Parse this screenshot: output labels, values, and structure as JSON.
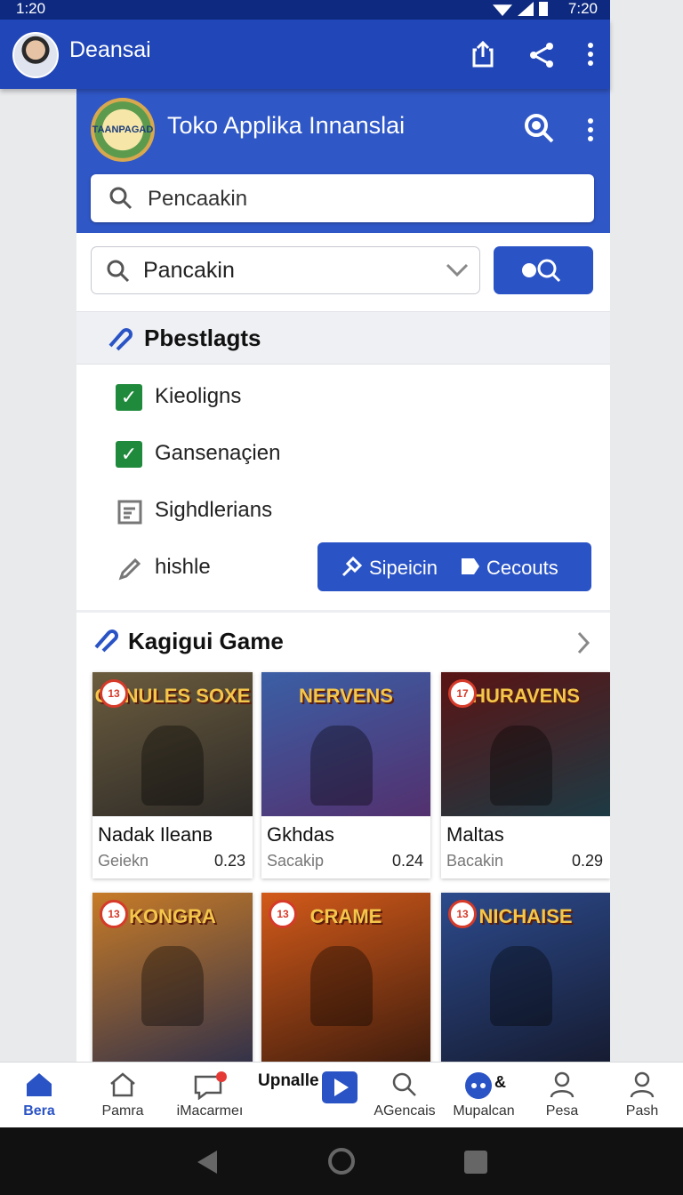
{
  "status_bar": {
    "time_left": "1:20",
    "time_right": "7:20"
  },
  "app_bar": {
    "title": "Deansai"
  },
  "store": {
    "logo_text": "TAANPAGAD",
    "title": "Toko Applika Innanslai",
    "search_placeholder": "Pencaakin"
  },
  "filter_bar": {
    "select_value": "Pancakin"
  },
  "section": {
    "title": "Pbestlagts"
  },
  "filters": [
    {
      "label": "Kieoligns",
      "icon": "checkbox-checked-icon"
    },
    {
      "label": "Gansenaçien",
      "icon": "checkbox-checked-icon"
    },
    {
      "label": "Sighdlerians",
      "icon": "list-icon"
    },
    {
      "label": "hishle",
      "icon": "pencil-icon"
    }
  ],
  "action_button": {
    "left_label": "Sipeicin",
    "right_label": "Cecouts"
  },
  "games": {
    "title": "Kagigui Game",
    "items": [
      {
        "art_title": "GUNULES SOXE",
        "rating": "13",
        "name": "Nadak Ileanв",
        "sub": "Geiekn",
        "price": "0.23",
        "art_colors": [
          "#6b5c3e",
          "#2d2a27"
        ]
      },
      {
        "art_title": "NERVENS",
        "rating": "",
        "name": "Gkhdas",
        "sub": "Sacakip",
        "price": "0.24",
        "art_colors": [
          "#3b5fa5",
          "#53306e"
        ]
      },
      {
        "art_title": "HURAVENS",
        "rating": "17",
        "name": "Maltas",
        "sub": "Bacakin",
        "price": "0.29",
        "art_colors": [
          "#5a1414",
          "#1d3a44"
        ]
      },
      {
        "art_title": "KONGRA",
        "rating": "13",
        "name": "",
        "sub": "",
        "price": "",
        "art_colors": [
          "#c77b27",
          "#2e2f4a"
        ]
      },
      {
        "art_title": "CRAME",
        "rating": "13",
        "name": "",
        "sub": "",
        "price": "",
        "art_colors": [
          "#d35a1a",
          "#3a1a0c"
        ]
      },
      {
        "art_title": "NICHAISE",
        "rating": "13",
        "name": "",
        "sub": "",
        "price": "",
        "art_colors": [
          "#2c4a8c",
          "#151a2e"
        ]
      }
    ]
  },
  "bottom_nav": [
    {
      "label": "Bera",
      "icon": "home-icon"
    },
    {
      "label": "Pamra",
      "icon": "outline-home-icon"
    },
    {
      "label": "iMacarmeı",
      "icon": "message-icon"
    },
    {
      "label": "Upnalle",
      "icon": "play-icon"
    },
    {
      "label": "AGencais",
      "icon": "search-icon"
    },
    {
      "label": "Mupalcan",
      "icon": "chat-icon",
      "badge": "&"
    },
    {
      "label": "Pesa",
      "icon": "person-icon"
    },
    {
      "label": "Pash",
      "icon": "person-icon"
    }
  ],
  "colors": {
    "primary": "#2146b8",
    "accent": "#2a53c5",
    "check_green": "#1f8a3c"
  }
}
